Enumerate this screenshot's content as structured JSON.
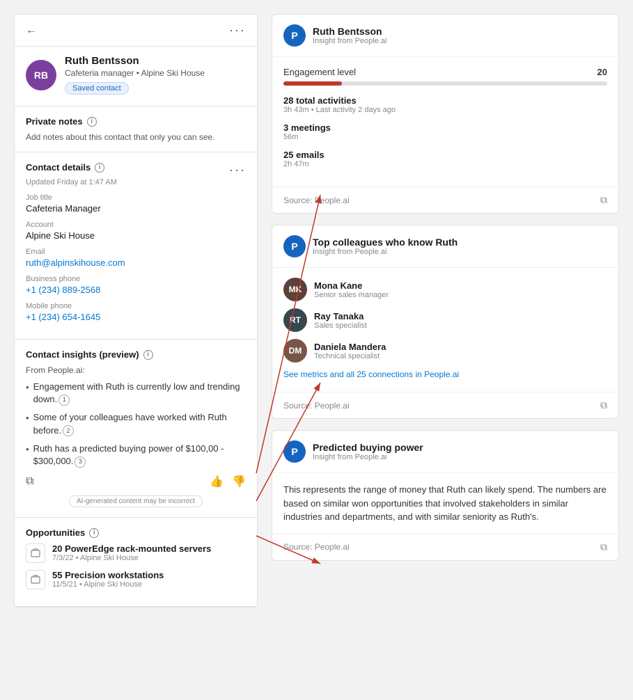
{
  "left": {
    "back_label": "←",
    "more_label": "···",
    "contact": {
      "initials": "RB",
      "name": "Ruth Bentsson",
      "role": "Cafeteria manager • Alpine Ski House",
      "saved_badge": "Saved contact"
    },
    "private_notes": {
      "title": "Private notes",
      "placeholder": "Add notes about this contact that only you can see."
    },
    "contact_details": {
      "title": "Contact details",
      "updated": "Updated Friday at 1:47 AM",
      "job_title_label": "Job title",
      "job_title_value": "Cafeteria Manager",
      "account_label": "Account",
      "account_value": "Alpine Ski House",
      "email_label": "Email",
      "email_value": "ruth@alpinskihouse.com",
      "biz_phone_label": "Business phone",
      "biz_phone_value": "+1 (234) 889-2568",
      "mobile_label": "Mobile phone",
      "mobile_value": "+1 (234) 654-1645"
    },
    "insights": {
      "title": "Contact insights (preview)",
      "from_label": "From People.ai:",
      "items": [
        {
          "text_parts": [
            "Engagement with ",
            "Ruth",
            " is currently low and trending down."
          ],
          "highlight_index": 1,
          "num": "1"
        },
        {
          "text_parts": [
            "Some of your colleagues have worked with ",
            "Ruth",
            " before."
          ],
          "highlight_index": 1,
          "num": "2"
        },
        {
          "text_parts": [
            "",
            "Ruth",
            " has a predicted buying power of $100,00 - $300,000."
          ],
          "highlight_index": 1,
          "num": "3"
        }
      ],
      "disclaimer": "AI-generated content may be incorrect"
    },
    "opportunities": {
      "title": "Opportunities",
      "items": [
        {
          "name": "20 PowerEdge rack-mounted servers",
          "meta": "7/3/22 • Alpine Ski House"
        },
        {
          "name": "55 Precision workstations",
          "meta": "11/5/21 • Alpine Ski House"
        }
      ]
    }
  },
  "right": {
    "card1": {
      "avatar_letter": "P",
      "title": "Ruth Bentsson",
      "subtitle": "Insight from People.ai",
      "engagement_label": "Engagement level",
      "engagement_score": "20",
      "progress_pct": 18,
      "total_activities_label": "28 total activities",
      "total_activities_sub": "3h 43m • Last activity 2 days ago",
      "meetings_label": "3 meetings",
      "meetings_sub": "56m",
      "emails_label": "25 emails",
      "emails_sub": "2h 47m",
      "source": "Source: People.ai"
    },
    "card2": {
      "avatar_letter": "P",
      "title": "Top colleagues who know Ruth",
      "subtitle": "Insight from People.ai",
      "colleagues": [
        {
          "name": "Mona Kane",
          "role": "Senior sales manager",
          "initials": "MK",
          "color": "#5D4037"
        },
        {
          "name": "Ray Tanaka",
          "role": "Sales specialist",
          "initials": "RT",
          "color": "#37474F"
        },
        {
          "name": "Daniela Mandera",
          "role": "Technical specialist",
          "initials": "DM",
          "color": "#795548"
        }
      ],
      "see_metrics": "See metrics and all 25 connections in People.ai",
      "source": "Source: People.ai"
    },
    "card3": {
      "avatar_letter": "P",
      "title": "Predicted buying power",
      "subtitle": "Insight from People.ai",
      "description": "This represents the range of money that Ruth can likely spend. The numbers are based on similar won opportunities that involved stakeholders in similar industries and departments, and with similar seniority as Ruth's.",
      "source": "Source: People.ai"
    }
  }
}
